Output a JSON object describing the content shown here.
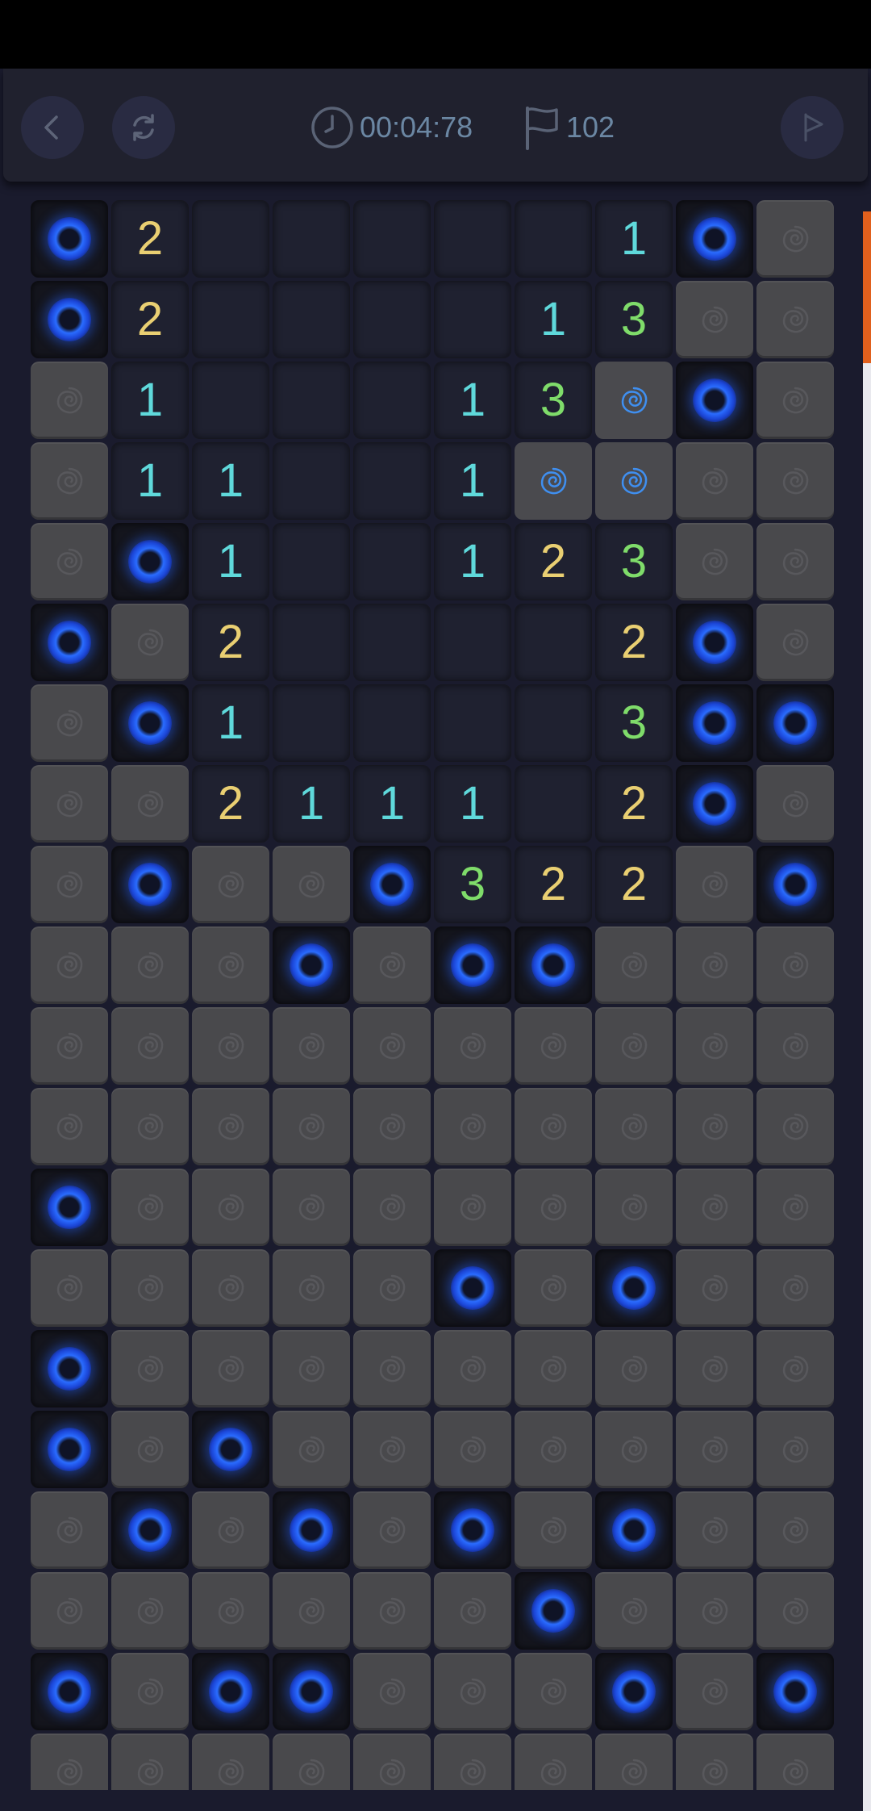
{
  "header": {
    "timer": "00:04:78",
    "flag_count": "102",
    "icons": {
      "back": "chevron-left-icon",
      "restart": "restart-icon",
      "timer": "clock-icon",
      "flags": "flag-icon",
      "flag_mode": "flag-icon"
    }
  },
  "colors": {
    "number_1": "#5fd9db",
    "number_2": "#e9cf72",
    "number_3": "#7fdc6a",
    "mine_glow": "#2a6cff",
    "scroll_thumb": "#e0601d"
  },
  "board": {
    "legend": {
      "H": "hidden",
      "O": "open-empty",
      "M": "revealed-mine",
      "F": "flagged",
      "1": "number 1",
      "2": "number 2",
      "3": "number 3"
    },
    "rows": [
      [
        "M",
        "2",
        "O",
        "O",
        "O",
        "O",
        "O",
        "1",
        "M",
        "H"
      ],
      [
        "M",
        "2",
        "O",
        "O",
        "O",
        "O",
        "1",
        "3",
        "H",
        "H"
      ],
      [
        "H",
        "1",
        "O",
        "O",
        "O",
        "1",
        "3",
        "F",
        "M",
        "H"
      ],
      [
        "H",
        "1",
        "1",
        "O",
        "O",
        "1",
        "F",
        "F",
        "H",
        "H"
      ],
      [
        "H",
        "M",
        "1",
        "O",
        "O",
        "1",
        "2",
        "3",
        "H",
        "H"
      ],
      [
        "M",
        "H",
        "2",
        "O",
        "O",
        "O",
        "O",
        "2",
        "M",
        "H"
      ],
      [
        "H",
        "M",
        "1",
        "O",
        "O",
        "O",
        "O",
        "3",
        "M",
        "M"
      ],
      [
        "H",
        "H",
        "2",
        "1",
        "1",
        "1",
        "O",
        "2",
        "M",
        "H"
      ],
      [
        "H",
        "M",
        "H",
        "H",
        "M",
        "3",
        "2",
        "2",
        "H",
        "M"
      ],
      [
        "H",
        "H",
        "H",
        "M",
        "H",
        "M",
        "M",
        "H",
        "H",
        "H"
      ],
      [
        "H",
        "H",
        "H",
        "H",
        "H",
        "H",
        "H",
        "H",
        "H",
        "H"
      ],
      [
        "H",
        "H",
        "H",
        "H",
        "H",
        "H",
        "H",
        "H",
        "H",
        "H"
      ],
      [
        "M",
        "H",
        "H",
        "H",
        "H",
        "H",
        "H",
        "H",
        "H",
        "H"
      ],
      [
        "H",
        "H",
        "H",
        "H",
        "H",
        "M",
        "H",
        "M",
        "H",
        "H"
      ],
      [
        "M",
        "H",
        "H",
        "H",
        "H",
        "H",
        "H",
        "H",
        "H",
        "H"
      ],
      [
        "M",
        "H",
        "M",
        "H",
        "H",
        "H",
        "H",
        "H",
        "H",
        "H"
      ],
      [
        "H",
        "M",
        "H",
        "M",
        "H",
        "M",
        "H",
        "M",
        "H",
        "H"
      ],
      [
        "H",
        "H",
        "H",
        "H",
        "H",
        "H",
        "M",
        "H",
        "H",
        "H"
      ],
      [
        "M",
        "H",
        "M",
        "M",
        "H",
        "H",
        "H",
        "M",
        "H",
        "M"
      ],
      [
        "H",
        "H",
        "H",
        "H",
        "H",
        "H",
        "H",
        "H",
        "H",
        "H"
      ]
    ]
  }
}
